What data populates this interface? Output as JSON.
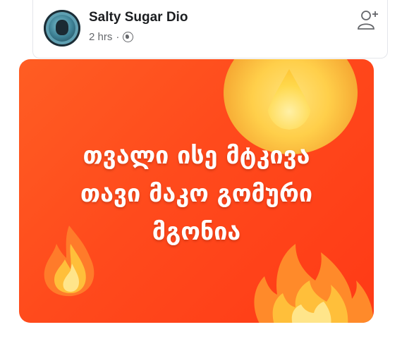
{
  "post": {
    "author": "Salty Sugar Dio",
    "time": "2 hrs",
    "separator": "·",
    "privacy_icon": "globe-icon",
    "action_icon": "add-friend-icon"
  },
  "image": {
    "lines": [
      "თვალი ისე მტკივა",
      "თავი მაკო გომური",
      "მგონია"
    ],
    "decorations": [
      "droplet-emoji",
      "fire-emoji",
      "fire-emoji"
    ],
    "background_color": "#ff4a1c"
  }
}
